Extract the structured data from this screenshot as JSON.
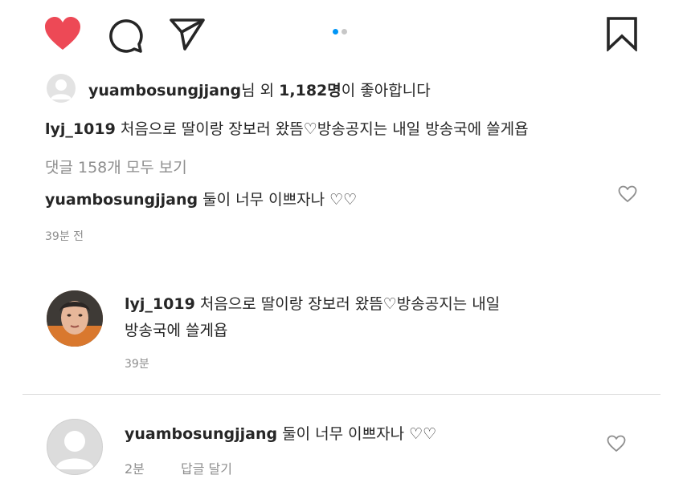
{
  "colors": {
    "like_red": "#ed4956",
    "active_dot": "#0095f6",
    "inactive_dot": "#c7c7c7",
    "muted_text": "#8e8e8e"
  },
  "actions": {
    "like_icon": "heart-filled-icon",
    "comment_icon": "comment-icon",
    "share_icon": "paper-plane-icon",
    "save_icon": "bookmark-icon"
  },
  "carousel": {
    "total": 2,
    "active_index": 1
  },
  "likes": {
    "username": "yuambosungjjang",
    "middle_text": "님 외 ",
    "count": "1,182명",
    "suffix": "이 좋아합니다"
  },
  "caption": {
    "username": "lyj_1019",
    "text": " 처음으로 딸이랑 장보러 왔뜸♡방송공지는 내일 방송국에 쓸게욥"
  },
  "view_comments": "댓글 158개 모두 보기",
  "top_comment": {
    "username": "yuambosungjjang",
    "text": " 둘이 너무 이쁘자나 ♡♡",
    "time": "39분 전"
  },
  "post_comment": {
    "username": "lyj_1019",
    "text_line1": " 처음으로 딸이랑 장보러 왔뜸♡방송공지는 내일",
    "text_line2": "방송국에 쓸게욥",
    "time": "39분"
  },
  "reply_comment": {
    "username": "yuambosungjjang",
    "text": " 둘이 너무 이쁘자나 ♡♡",
    "time": "2분",
    "reply_label": "답글 달기"
  }
}
